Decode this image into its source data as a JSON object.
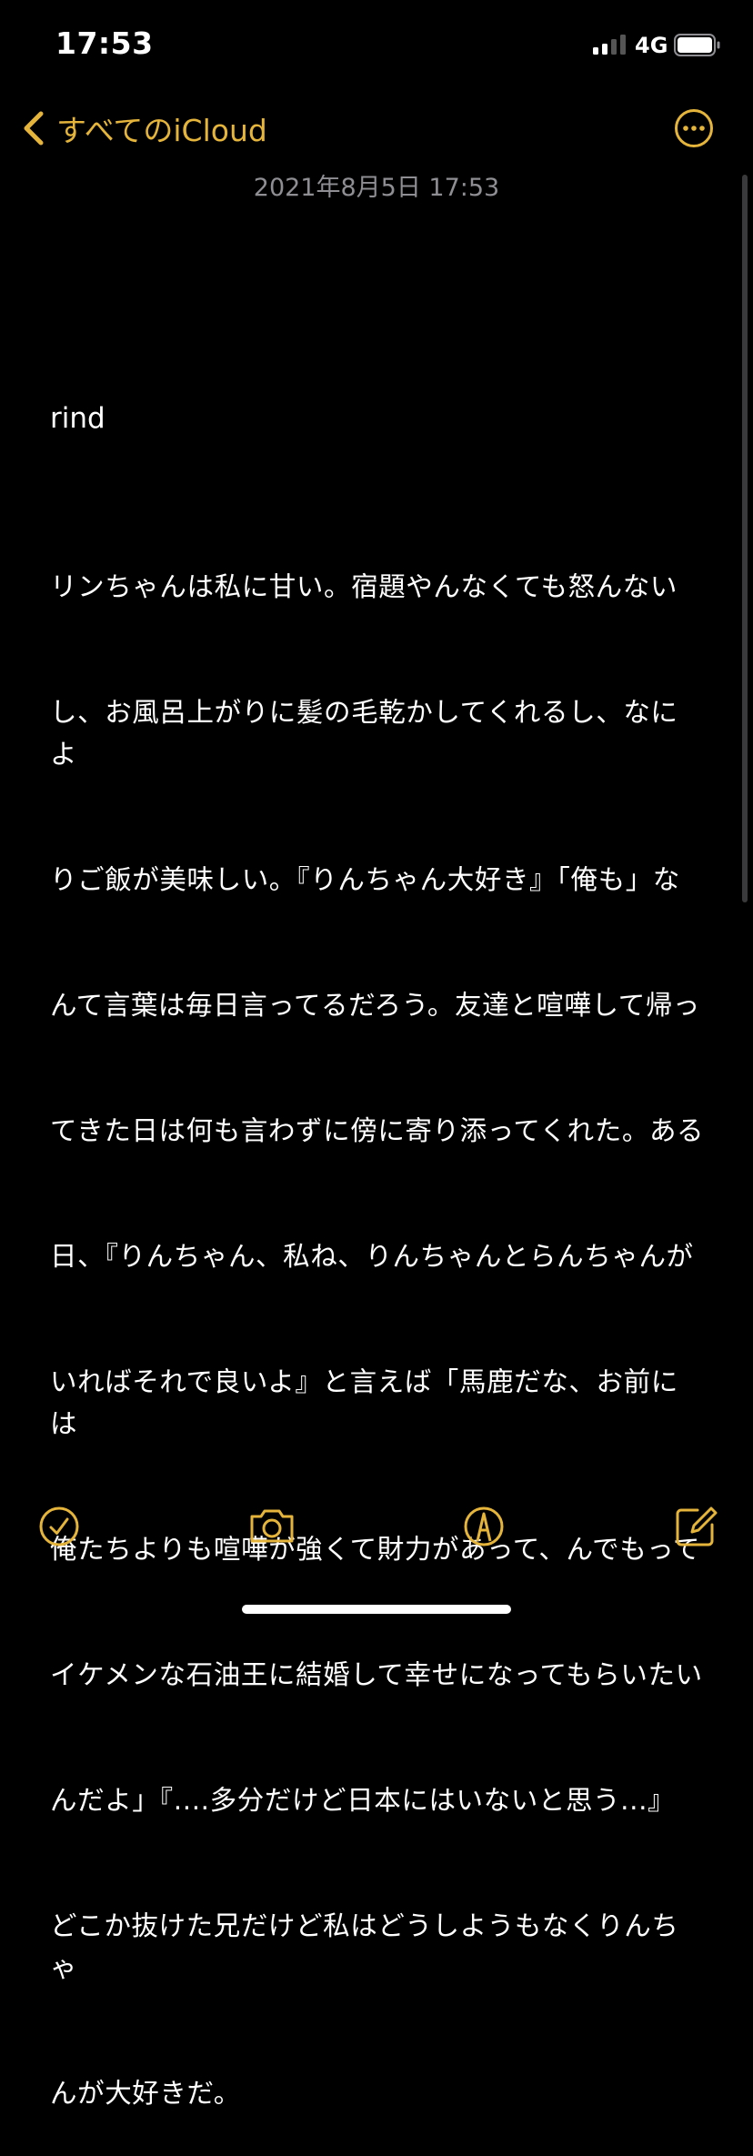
{
  "status_bar": {
    "time": "17:53",
    "network": "4G",
    "icons": [
      "signal-icon",
      "battery-icon"
    ]
  },
  "nav": {
    "back_label": "すべてのiCloud",
    "back_icon": "chevron-left-icon",
    "more_icon": "ellipsis-circle-icon"
  },
  "note": {
    "date": "2021年8月5日 17:53",
    "title": "rind",
    "body_lines": [
      "リンちゃんは私に甘い。宿題やんなくても怒んない",
      "し、お風呂上がりに髪の毛乾かしてくれるし、なによ",
      "りご飯が美味しい。『りんちゃん大好き』「俺も」な",
      "んて言葉は毎日言ってるだろう。友達と喧嘩して帰っ",
      "てきた日は何も言わずに傍に寄り添ってくれた。ある",
      "日、『りんちゃん、私ね、りんちゃんとらんちゃんが",
      "いればそれで良いよ』と言えば「馬鹿だな、お前には",
      "俺たちよりも喧嘩が強くて財力があって、んでもって",
      "イケメンな石油王に結婚して幸せになってもらいたい",
      "んだよ」『....多分だけど日本にはいないと思う...』",
      "どこか抜けた兄だけど私はどうしようもなくりんちゃ",
      "んが大好きだ。"
    ]
  },
  "toolbar": {
    "icons": [
      "checklist-icon",
      "camera-icon",
      "markup-icon",
      "compose-icon"
    ]
  },
  "colors": {
    "accent": "#e5b53b",
    "background": "#000000",
    "text": "#ffffff",
    "secondary_text": "#8e8e93"
  }
}
